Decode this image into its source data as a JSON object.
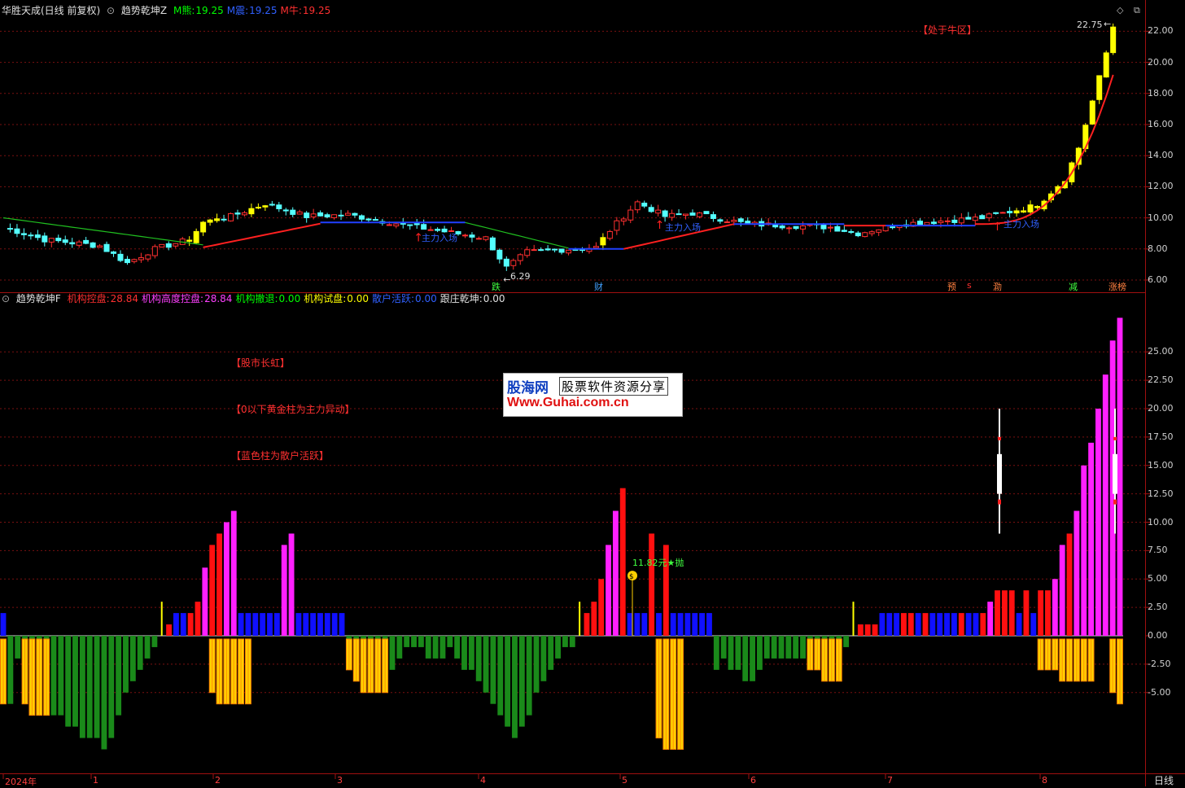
{
  "top_header": {
    "stock": "华胜天成(日线 前复权)",
    "indicator": "趋势乾坤Z",
    "items": [
      {
        "label": "M熊:",
        "value": "19.25",
        "color": "#00ff00"
      },
      {
        "label": "M震:",
        "value": "19.25",
        "color": "#3060ff"
      },
      {
        "label": "M牛:",
        "value": "19.25",
        "color": "#ff3030"
      }
    ]
  },
  "bottom_header": {
    "indicator": "趋势乾坤F",
    "items": [
      {
        "label": "机构控盘:",
        "value": "28.84",
        "color": "#ff3030"
      },
      {
        "label": "机构高度控盘:",
        "value": "28.84",
        "color": "#ff40ff"
      },
      {
        "label": "机构撤退:",
        "value": "0.00",
        "color": "#00ff00"
      },
      {
        "label": "机构试盘:",
        "value": "0.00",
        "color": "#ffff00"
      },
      {
        "label": "散户活跃:",
        "value": "0.00",
        "color": "#3060ff"
      },
      {
        "label": "跟庄乾坤:",
        "value": "0.00",
        "color": "#e0e0e0"
      }
    ]
  },
  "notes": {
    "bull_zone": "【处于牛区】",
    "rainbow": "【股市长虹】",
    "gold_bar": "【0以下黄金柱为主力异动】",
    "blue_bar": "【蓝色柱为散户活跃】"
  },
  "watermark": {
    "name": "股海网",
    "tagline": "股票软件资源分享",
    "url": "Www.Guhai.com.cn"
  },
  "price_chart": {
    "y_ticks": [
      "22.00",
      "20.00",
      "18.00",
      "16.00",
      "14.00",
      "12.00",
      "10.00",
      "8.00",
      "6.00"
    ],
    "high_label": "22.75",
    "low_label": "6.29",
    "signals": [
      "跌",
      "财",
      "预",
      "s",
      "泐",
      "减",
      "涨榜"
    ],
    "annotations": [
      "主力入场",
      "主力入场",
      "主力入场"
    ]
  },
  "indicator_chart": {
    "y_ticks": [
      "25.00",
      "22.50",
      "20.00",
      "17.50",
      "15.00",
      "12.50",
      "10.00",
      "7.50",
      "5.00",
      "2.50",
      "0.00",
      "-2.50",
      "-5.00"
    ],
    "sell_label": "11.82元★抛"
  },
  "x_axis": {
    "labels": [
      "2024年",
      "1",
      "2",
      "3",
      "4",
      "5",
      "6",
      "7",
      "8"
    ]
  },
  "period_label": "日线",
  "colors": {
    "up": "#ff3030",
    "down": "#54ffff",
    "yellow": "#ffff00",
    "bull_line": "#ff2020",
    "range_line": "#2040ff",
    "bear_line": "#20c020",
    "grid": "#7a1010",
    "green_bar": "#1a8a1a",
    "gold_bar": "#ffcc00"
  }
}
